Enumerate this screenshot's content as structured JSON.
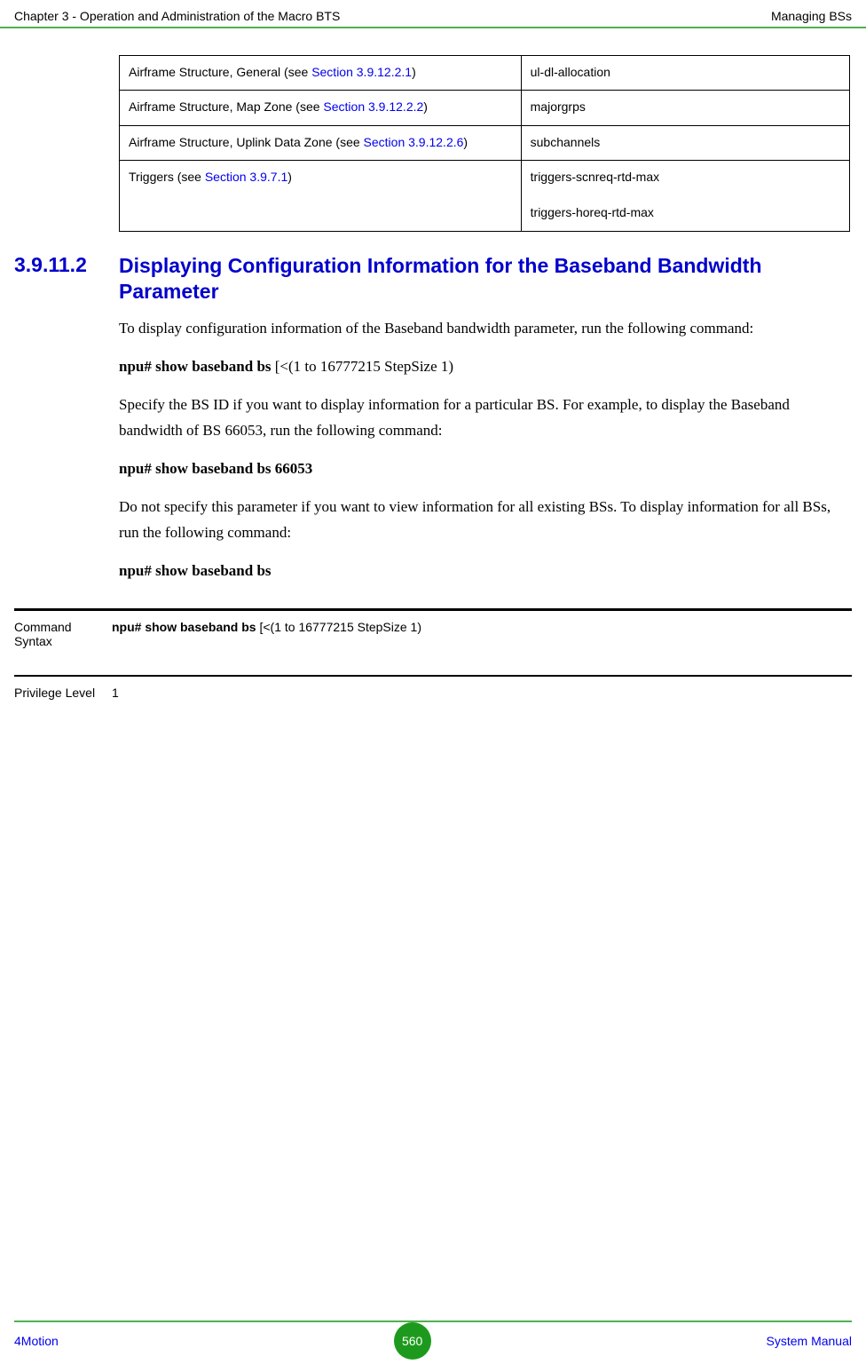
{
  "header": {
    "left": "Chapter 3 - Operation and Administration of the Macro BTS",
    "right": "Managing BSs"
  },
  "refTable": {
    "rows": [
      {
        "left_pre": "Airframe Structure, General (see ",
        "left_link": "Section 3.9.12.2.1",
        "left_post": ")",
        "right": "ul-dl-allocation"
      },
      {
        "left_pre": "Airframe Structure, Map Zone (see ",
        "left_link": "Section 3.9.12.2.2",
        "left_post": ")",
        "right": "majorgrps"
      },
      {
        "left_pre": "Airframe Structure, Uplink Data Zone (see ",
        "left_link": "Section 3.9.12.2.6",
        "left_post": ")",
        "right": "subchannels"
      },
      {
        "left_pre": "Triggers (see ",
        "left_link": "Section 3.9.7.1",
        "left_post": ")",
        "right": "triggers-scnreq-rtd-max\n\ntriggers-horeq-rtd-max"
      }
    ]
  },
  "section": {
    "number": "3.9.11.2",
    "title": "Displaying Configuration Information for the Baseband Bandwidth Parameter"
  },
  "paragraphs": {
    "p1": "To display configuration information of the Baseband bandwidth parameter, run the following command:",
    "c1a": "npu# show baseband bs ",
    "c1b": "[<(1 to 16777215 StepSize 1)",
    "p2": "Specify the BS ID if you want to display information for a particular BS. For example, to display the Baseband bandwidth of BS 66053, run the following command:",
    "c2": "npu# show baseband bs 66053",
    "p3": "Do not specify this parameter if you want to view information for all existing BSs. To display information for all BSs, run the following command:",
    "c3": "npu# show baseband bs"
  },
  "cmdTable": {
    "syntaxLabel": "Command Syntax",
    "syntaxBold": "npu# show baseband bs ",
    "syntaxRest": "[<(1 to 16777215 StepSize 1)",
    "privLabel": "Privilege Level",
    "privValue": "1"
  },
  "footer": {
    "left": "4Motion",
    "page": "560",
    "right": "System Manual"
  }
}
